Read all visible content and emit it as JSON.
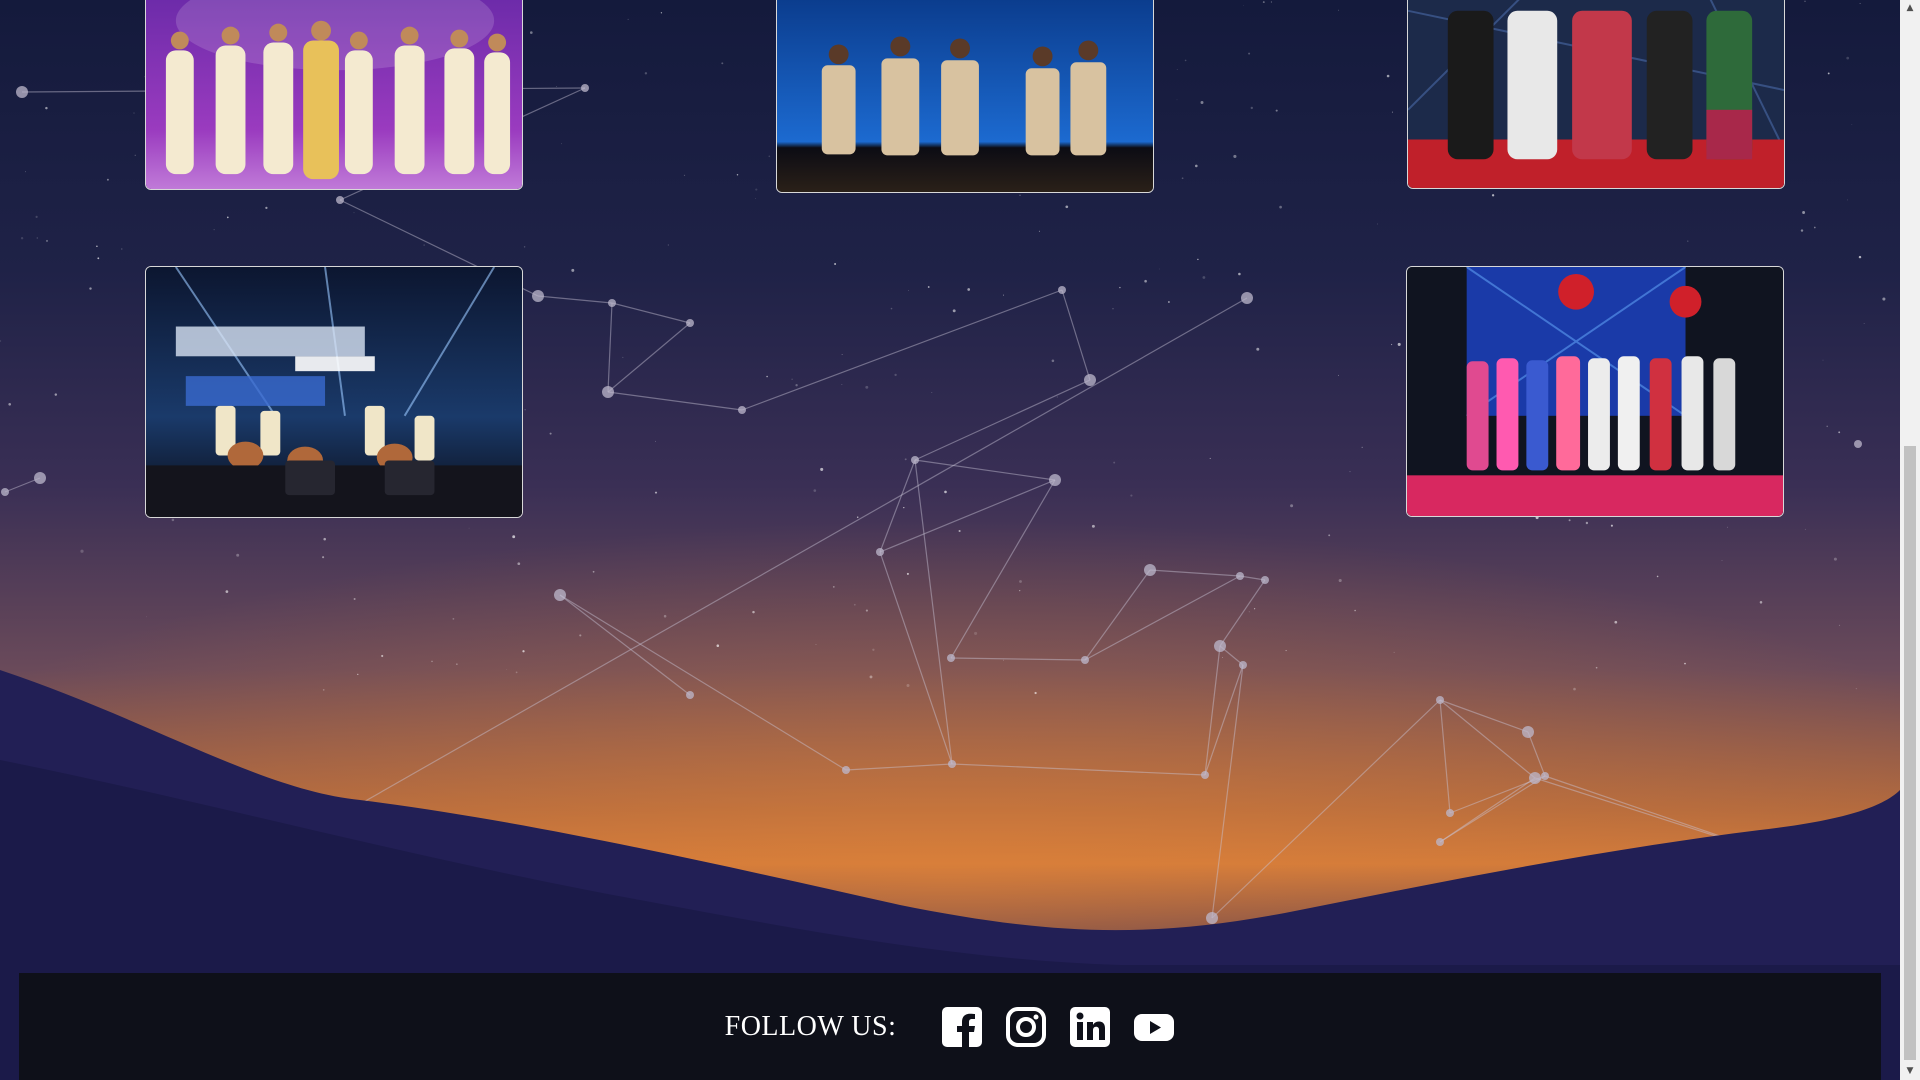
{
  "gallery": {
    "photos": [
      {
        "name": "dance-troupe-purple-stage",
        "row": 1,
        "col": 1
      },
      {
        "name": "dance-group-blue-stage",
        "row": 1,
        "col": 2
      },
      {
        "name": "group-photo-red-carpet",
        "row": 1,
        "col": 3
      },
      {
        "name": "taiwan-drum-performance",
        "row": 2,
        "col": 1
      },
      {
        "name": "firetron-award-group-photo",
        "row": 2,
        "col": 3
      }
    ]
  },
  "footer": {
    "follow_label": "FOLLOW US:",
    "social": [
      {
        "name": "facebook",
        "icon": "facebook-icon"
      },
      {
        "name": "instagram",
        "icon": "instagram-icon"
      },
      {
        "name": "linkedin",
        "icon": "linkedin-icon"
      },
      {
        "name": "youtube",
        "icon": "youtube-icon"
      }
    ]
  },
  "colors": {
    "footer_bg": "#0e1019",
    "text": "#ffffff",
    "sky_top": "#141a3c",
    "horizon_glow": "#d0793a"
  }
}
